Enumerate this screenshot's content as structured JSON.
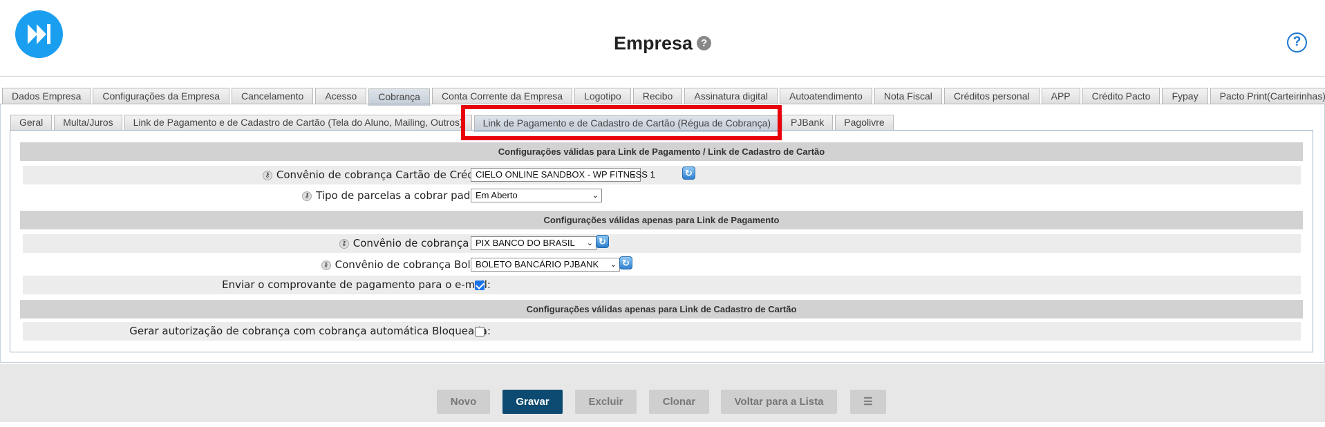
{
  "header": {
    "title": "Empresa",
    "title_help_glyph": "?",
    "help_glyph": "?",
    "logo_icon": "fast-forward-logo",
    "accent_color": "#1a9ef0"
  },
  "tabs": [
    {
      "label": "Dados Empresa"
    },
    {
      "label": "Configurações da Empresa"
    },
    {
      "label": "Cancelamento"
    },
    {
      "label": "Acesso"
    },
    {
      "label": "Cobrança",
      "active": true
    },
    {
      "label": "Conta Corrente da Empresa"
    },
    {
      "label": "Logotipo"
    },
    {
      "label": "Recibo"
    },
    {
      "label": "Assinatura digital"
    },
    {
      "label": "Autoatendimento"
    },
    {
      "label": "Nota Fiscal"
    },
    {
      "label": "Créditos personal"
    },
    {
      "label": "APP"
    },
    {
      "label": "Crédito Pacto"
    },
    {
      "label": "Fypay"
    },
    {
      "label": "Pacto Print(Carteirinhas)"
    }
  ],
  "subtabs": [
    {
      "label": "Geral"
    },
    {
      "label": "Multa/Juros"
    },
    {
      "label": "Link de Pagamento e de Cadastro de Cartão (Tela do Aluno, Mailing, Outros)"
    },
    {
      "label": "Link de Pagamento e de Cadastro de Cartão (Régua de Cobrança)",
      "active": true
    },
    {
      "label": "PJBank"
    },
    {
      "label": "Pagolivre"
    }
  ],
  "highlight_color": "#e8000b",
  "form": {
    "section1": "Configurações válidas para Link de Pagamento / Link de Cadastro de Cartão",
    "section2": "Configurações válidas apenas para Link de Pagamento",
    "section3": "Configurações válidas apenas para Link de Cadastro de Cartão",
    "key_glyph": "⚷",
    "refresh_glyph": "↻",
    "chevron_glyph": "⌄",
    "rows": [
      {
        "label": "Convênio de cobrança Cartão de Crédito:",
        "value": "CIELO ONLINE SANDBOX - WP FITNESS 1"
      },
      {
        "label": "Tipo de parcelas a cobrar padrão:",
        "value": "Em Aberto"
      },
      {
        "label": "Convênio de cobrança Pix:",
        "value": "PIX BANCO DO BRASIL"
      },
      {
        "label": "Convênio de cobrança Boleto:",
        "value": "BOLETO BANCÁRIO PJBANK"
      },
      {
        "label": "Enviar o comprovante de pagamento para o e-mail:",
        "checked": true
      },
      {
        "label": "Gerar autorização de cobrança com cobrança automática Bloqueada:",
        "checked": false
      }
    ]
  },
  "footer": {
    "novo": "Novo",
    "gravar": "Gravar",
    "excluir": "Excluir",
    "clonar": "Clonar",
    "voltar": "Voltar para a Lista",
    "list_glyph": "☰",
    "primary_color": "#0d4a72"
  }
}
